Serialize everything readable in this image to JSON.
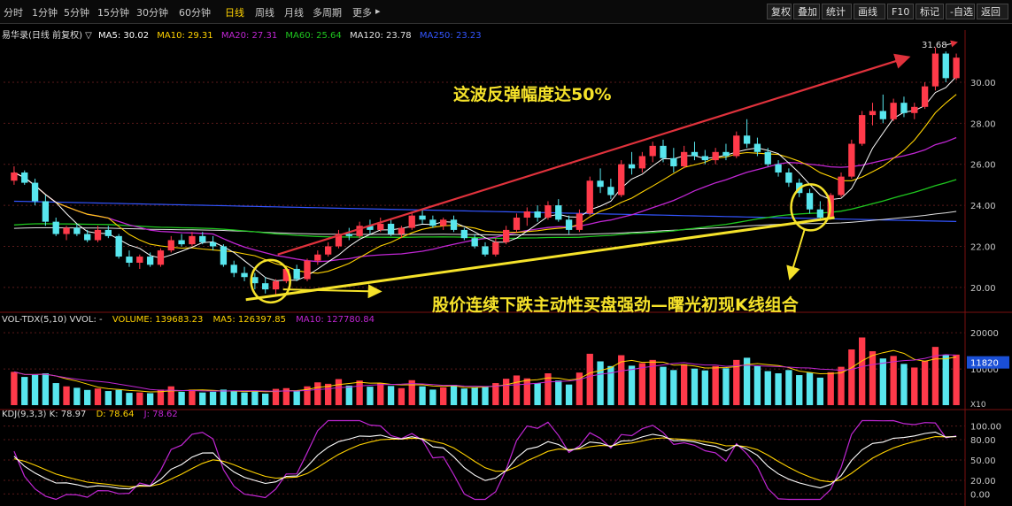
{
  "toolbar": {
    "timeframes": [
      "分时",
      "1分钟",
      "5分钟",
      "15分钟",
      "30分钟",
      "60分钟",
      "日线",
      "周线",
      "月线",
      "多周期",
      "更多"
    ],
    "active_timeframe": "日线",
    "right_buttons": [
      "复权",
      "叠加",
      "统计",
      "画线",
      "F10",
      "标记",
      "-自选",
      "返回"
    ]
  },
  "price_legend": {
    "title": "易华录(日线 前复权) ▽",
    "ma5": "MA5: 30.02",
    "ma10": "MA10: 29.31",
    "ma20": "MA20: 27.31",
    "ma60": "MA60: 25.64",
    "ma120": "MA120: 23.78",
    "ma250": "MA250: 23.23"
  },
  "volume_legend": {
    "title": "VOL-TDX(5,10) VVOL: -",
    "volume": "VOLUME: 139683.23",
    "ma5": "MA5: 126397.85",
    "ma10": "MA10: 127780.84"
  },
  "kdj_legend": {
    "title": "KDJ(9,3,3) K: 78.97",
    "d": "D: 78.64",
    "j": "J: 78.62"
  },
  "annotations": {
    "rebound_text": "这波反弹幅度达50%",
    "pattern_text": "股价连续下跌主动性买盘强劲—曙光初现K线组合",
    "peak_label": "31.68"
  },
  "colors": {
    "up": "#ff3a4a",
    "down": "#58e6ee",
    "ma5": "#ffffff",
    "ma10": "#ffd200",
    "ma20": "#c026d3",
    "ma60": "#1fc71f",
    "ma120": "#e0e0e0",
    "ma250": "#3355ff",
    "annotation": "#f5e22a",
    "trend_arrow": "#e0323c",
    "grid": "#5a1a1a"
  },
  "chart_data": {
    "type": "candlestick",
    "price_axis": {
      "ticks": [
        20.0,
        22.0,
        24.0,
        26.0,
        28.0,
        30.0
      ],
      "min": 19.0,
      "max": 32.2
    },
    "volume_axis": {
      "ticks": [
        "20000",
        "10000"
      ],
      "scale_label": "X10",
      "current_marker": "11820",
      "max": 22000
    },
    "kdj_axis": {
      "ticks": [
        "100.00",
        "80.00",
        "50.00",
        "20.00",
        "0.00"
      ],
      "min": -10,
      "max": 110
    },
    "candles": [
      [
        25.2,
        25.9,
        25.0,
        25.6
      ],
      [
        25.6,
        25.7,
        25.0,
        25.1
      ],
      [
        25.1,
        25.3,
        24.0,
        24.2
      ],
      [
        24.2,
        24.5,
        23.0,
        23.2
      ],
      [
        23.2,
        23.4,
        22.5,
        22.6
      ],
      [
        22.6,
        23.0,
        22.3,
        22.9
      ],
      [
        22.9,
        23.1,
        22.5,
        22.6
      ],
      [
        22.6,
        22.8,
        22.2,
        22.3
      ],
      [
        22.3,
        23.0,
        22.2,
        22.8
      ],
      [
        22.8,
        23.0,
        22.4,
        22.5
      ],
      [
        22.5,
        22.6,
        21.4,
        21.5
      ],
      [
        21.5,
        21.8,
        21.0,
        21.2
      ],
      [
        21.2,
        21.6,
        20.9,
        21.5
      ],
      [
        21.5,
        21.7,
        21.0,
        21.1
      ],
      [
        21.1,
        21.9,
        21.0,
        21.8
      ],
      [
        21.8,
        22.5,
        21.7,
        22.3
      ],
      [
        22.3,
        22.6,
        22.0,
        22.1
      ],
      [
        22.1,
        22.7,
        22.0,
        22.5
      ],
      [
        22.5,
        22.7,
        22.1,
        22.2
      ],
      [
        22.2,
        22.5,
        21.8,
        22.0
      ],
      [
        22.0,
        22.1,
        21.0,
        21.1
      ],
      [
        21.1,
        21.3,
        20.5,
        20.7
      ],
      [
        20.7,
        21.0,
        20.3,
        20.5
      ],
      [
        20.5,
        20.7,
        19.9,
        20.2
      ],
      [
        20.2,
        20.5,
        19.7,
        19.9
      ],
      [
        19.9,
        20.4,
        19.6,
        20.3
      ],
      [
        20.3,
        21.0,
        20.2,
        20.9
      ],
      [
        20.9,
        21.1,
        20.3,
        20.4
      ],
      [
        20.4,
        21.4,
        20.3,
        21.3
      ],
      [
        21.3,
        21.8,
        21.1,
        21.6
      ],
      [
        21.6,
        22.2,
        21.5,
        22.0
      ],
      [
        22.0,
        22.8,
        21.9,
        22.6
      ],
      [
        22.6,
        22.9,
        22.3,
        22.5
      ],
      [
        22.5,
        23.2,
        22.4,
        23.0
      ],
      [
        23.0,
        23.3,
        22.6,
        22.8
      ],
      [
        22.8,
        23.4,
        22.7,
        23.1
      ],
      [
        23.1,
        23.3,
        22.5,
        22.6
      ],
      [
        22.6,
        23.0,
        22.4,
        22.9
      ],
      [
        22.9,
        23.7,
        22.8,
        23.5
      ],
      [
        23.5,
        23.8,
        23.1,
        23.3
      ],
      [
        23.3,
        23.5,
        22.9,
        23.0
      ],
      [
        23.0,
        23.4,
        22.8,
        23.3
      ],
      [
        23.3,
        23.5,
        22.7,
        22.8
      ],
      [
        22.8,
        22.9,
        22.3,
        22.4
      ],
      [
        22.4,
        22.6,
        21.9,
        22.0
      ],
      [
        22.0,
        22.2,
        21.5,
        21.6
      ],
      [
        21.6,
        22.4,
        21.5,
        22.2
      ],
      [
        22.2,
        23.0,
        22.1,
        22.8
      ],
      [
        22.8,
        23.6,
        22.7,
        23.4
      ],
      [
        23.4,
        23.9,
        23.0,
        23.7
      ],
      [
        23.7,
        24.0,
        23.2,
        23.4
      ],
      [
        23.4,
        24.2,
        23.3,
        24.0
      ],
      [
        24.0,
        24.3,
        23.2,
        23.3
      ],
      [
        23.3,
        23.5,
        22.6,
        22.8
      ],
      [
        22.8,
        23.8,
        22.7,
        23.6
      ],
      [
        23.6,
        25.4,
        23.5,
        25.2
      ],
      [
        25.2,
        25.8,
        24.6,
        24.9
      ],
      [
        24.9,
        25.3,
        24.3,
        24.5
      ],
      [
        24.5,
        26.2,
        24.4,
        26.0
      ],
      [
        26.0,
        26.6,
        25.5,
        25.8
      ],
      [
        25.8,
        26.6,
        25.6,
        26.4
      ],
      [
        26.4,
        27.1,
        26.1,
        26.9
      ],
      [
        26.9,
        27.2,
        26.1,
        26.3
      ],
      [
        26.3,
        26.8,
        25.6,
        25.9
      ],
      [
        25.9,
        26.9,
        25.8,
        26.6
      ],
      [
        26.6,
        27.1,
        26.2,
        26.4
      ],
      [
        26.4,
        26.7,
        26.0,
        26.2
      ],
      [
        26.2,
        26.8,
        26.0,
        26.6
      ],
      [
        26.6,
        27.0,
        26.2,
        26.4
      ],
      [
        26.4,
        27.6,
        26.3,
        27.4
      ],
      [
        27.4,
        28.2,
        26.8,
        27.0
      ],
      [
        27.0,
        27.3,
        26.4,
        26.6
      ],
      [
        26.6,
        26.8,
        25.9,
        26.0
      ],
      [
        26.0,
        26.2,
        25.4,
        25.6
      ],
      [
        25.6,
        25.8,
        24.9,
        25.1
      ],
      [
        25.1,
        25.3,
        24.4,
        24.6
      ],
      [
        24.6,
        24.8,
        23.6,
        23.8
      ],
      [
        23.8,
        24.2,
        23.3,
        23.4
      ],
      [
        23.4,
        24.6,
        23.3,
        24.5
      ],
      [
        24.5,
        25.6,
        24.4,
        25.4
      ],
      [
        25.4,
        27.2,
        25.3,
        27.0
      ],
      [
        27.0,
        28.6,
        26.9,
        28.4
      ],
      [
        28.4,
        29.0,
        27.9,
        28.6
      ],
      [
        28.6,
        29.4,
        28.0,
        28.2
      ],
      [
        28.2,
        29.2,
        28.1,
        29.0
      ],
      [
        29.0,
        29.3,
        28.3,
        28.5
      ],
      [
        28.5,
        29.0,
        28.2,
        28.8
      ],
      [
        28.8,
        30.0,
        28.7,
        29.8
      ],
      [
        29.8,
        31.7,
        29.6,
        31.4
      ],
      [
        31.4,
        31.5,
        30.0,
        30.2
      ],
      [
        30.2,
        31.4,
        30.1,
        31.2
      ]
    ],
    "volume_scale_note": "volume values in 手 ×10 units of the axis",
    "volumes": [
      9200,
      7800,
      8400,
      8800,
      6100,
      5200,
      4800,
      4200,
      4600,
      3900,
      4200,
      3400,
      3500,
      3300,
      4300,
      5200,
      3700,
      4300,
      3500,
      3700,
      4300,
      3800,
      3500,
      3900,
      3200,
      4500,
      4700,
      3900,
      5200,
      6300,
      5900,
      7200,
      5400,
      6800,
      5100,
      6100,
      5300,
      4700,
      6900,
      5200,
      4300,
      4900,
      5600,
      4600,
      4900,
      5200,
      6100,
      7300,
      8200,
      7400,
      6100,
      8800,
      6800,
      5700,
      9000,
      14200,
      12100,
      10800,
      13800,
      10900,
      11600,
      12500,
      10600,
      9700,
      11300,
      10100,
      9600,
      10800,
      10200,
      12500,
      13100,
      10800,
      9400,
      8800,
      9700,
      8300,
      9000,
      7600,
      9100,
      10600,
      15400,
      18700,
      14900,
      12900,
      13600,
      11400,
      10400,
      12300,
      16100,
      13800,
      13968
    ]
  }
}
